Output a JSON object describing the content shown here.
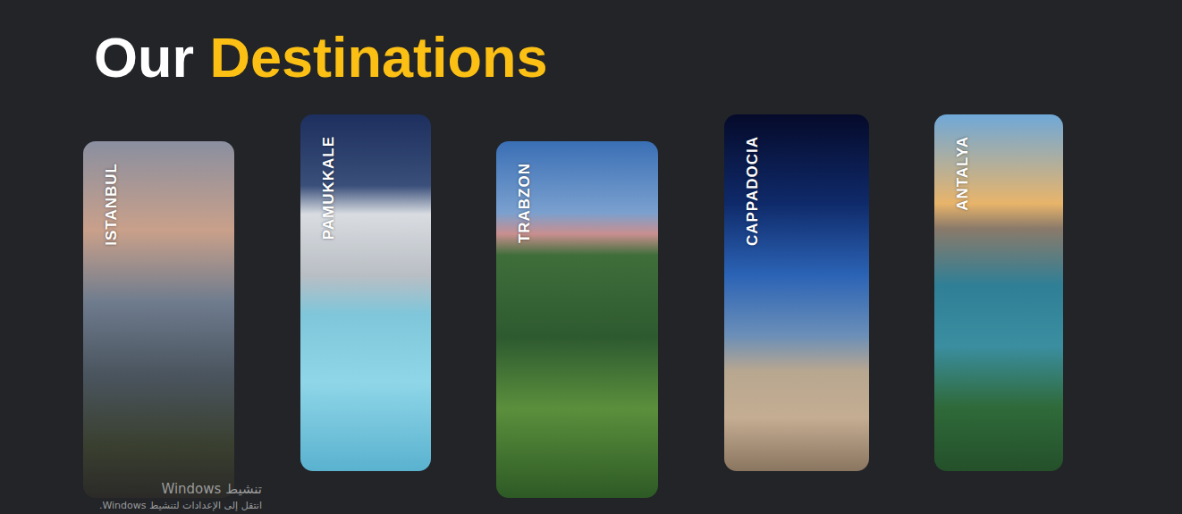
{
  "section": {
    "title_plain": "Our",
    "title_accent": "Destinations"
  },
  "destinations": [
    {
      "name": "ISTANBUL"
    },
    {
      "name": "PAMUKKALE"
    },
    {
      "name": "TRABZON"
    },
    {
      "name": "CAPPADOCIA"
    },
    {
      "name": "ANTALYA"
    }
  ],
  "watermark": {
    "title": "تنشيط Windows",
    "subtitle": "انتقل إلى الإعدادات لتنشيط Windows."
  }
}
